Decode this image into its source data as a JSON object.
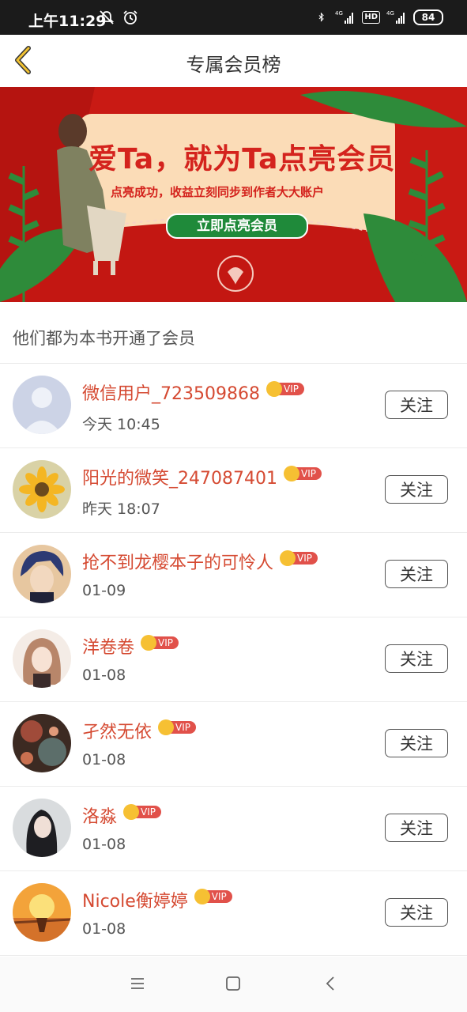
{
  "status_bar": {
    "time": "上午11:29",
    "battery": "84",
    "hd": "HD",
    "net1": "4G",
    "net2": "4G"
  },
  "header": {
    "title": "专属会员榜"
  },
  "banner": {
    "headline": "爱Ta，就为Ta点亮会员",
    "subline": "点亮成功，收益立刻同步到作者大大账户",
    "cta_label": "立即点亮会员"
  },
  "section_title": "他们都为本书开通了会员",
  "vip_label": "VIP",
  "follow_label": "关注",
  "members": [
    {
      "name": "微信用户_723509868",
      "time": "今天 10:45"
    },
    {
      "name": "阳光的微笑_247087401",
      "time": "昨天 18:07"
    },
    {
      "name": "抢不到龙樱本子的可怜人",
      "time": "01-09"
    },
    {
      "name": "洋卷卷",
      "time": "01-08"
    },
    {
      "name": "孑然无依",
      "time": "01-08"
    },
    {
      "name": "洛淼",
      "time": "01-08"
    },
    {
      "name": "Nicole衡婷婷",
      "time": "01-08"
    }
  ],
  "colors": {
    "accent": "#d54a32",
    "banner_red": "#c91a14",
    "vip_red": "#e1514a",
    "crown_gold": "#f6c033"
  },
  "icons": {
    "back": "chevron-left-icon",
    "menu": "menu-icon",
    "home": "square-home-icon",
    "nav_back": "back-triangle-icon"
  }
}
